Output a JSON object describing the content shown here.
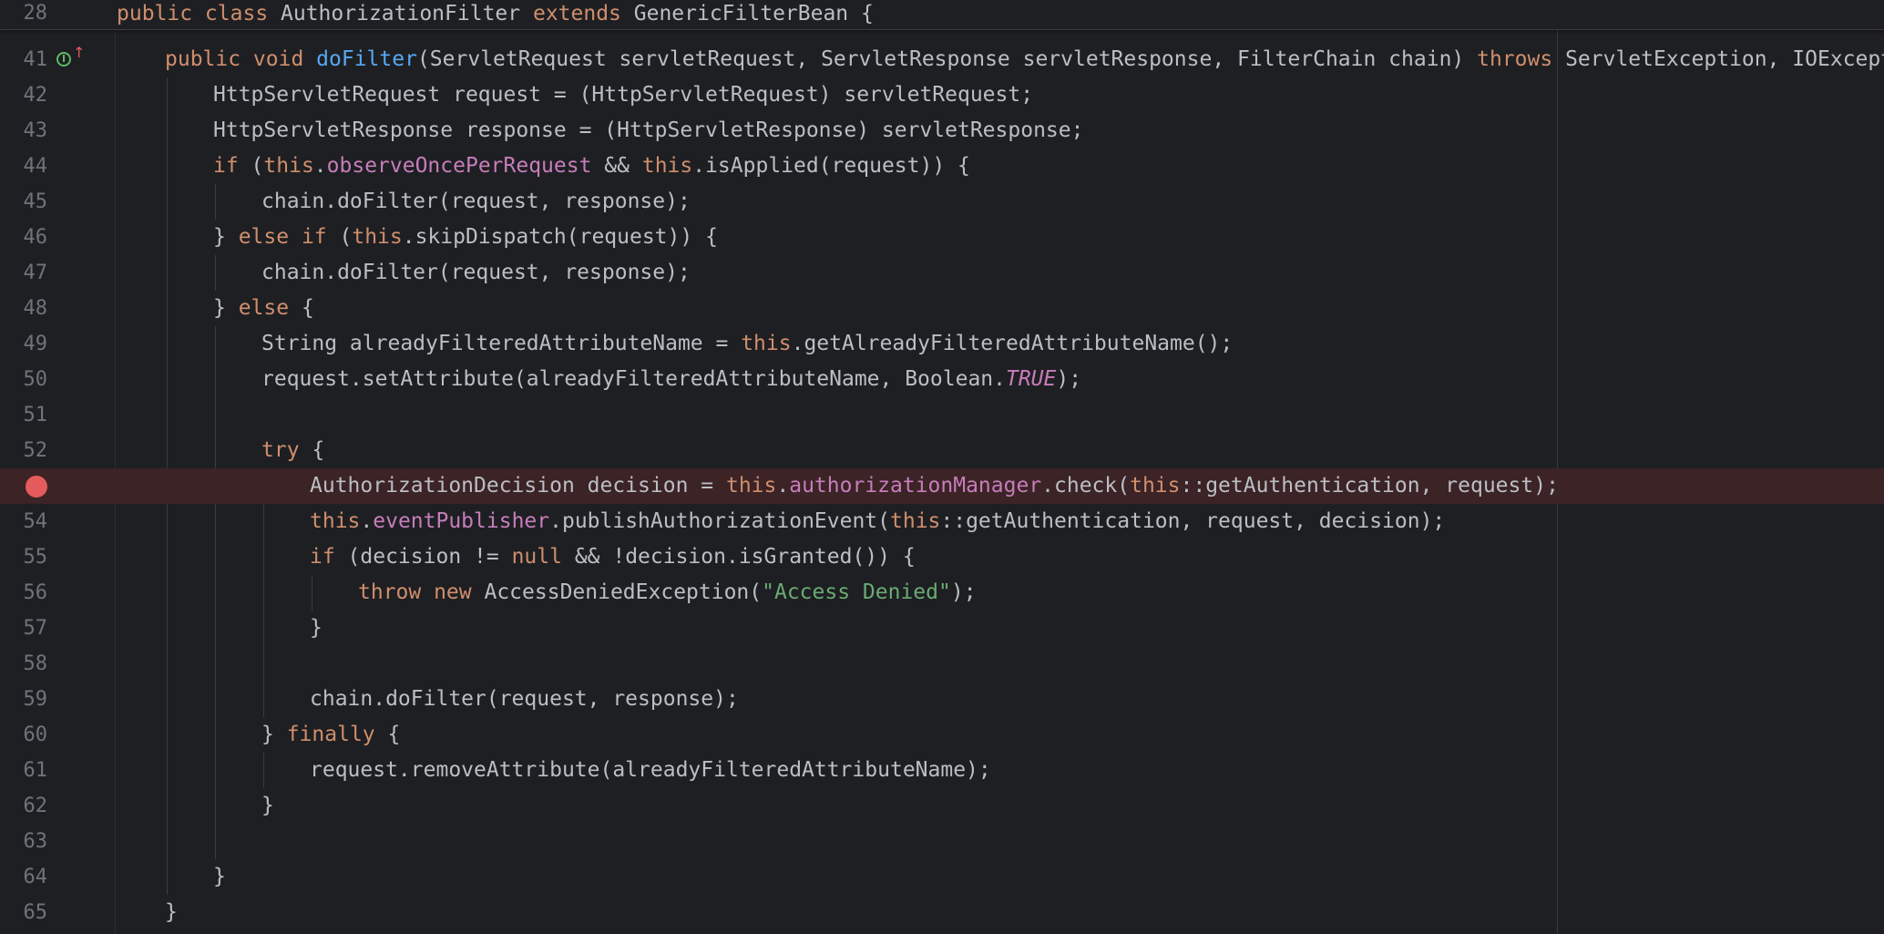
{
  "editor": {
    "sticky_header": {
      "line_number": "28",
      "tokens": [
        {
          "t": "public class ",
          "c": "kw"
        },
        {
          "t": "AuthorizationFilter ",
          "c": "txt"
        },
        {
          "t": "extends ",
          "c": "kw"
        },
        {
          "t": "GenericFilterBean {",
          "c": "txt"
        }
      ]
    },
    "lines": [
      {
        "n": "41",
        "indent": 1,
        "impl": true,
        "tokens": [
          {
            "t": "public void ",
            "c": "kw"
          },
          {
            "t": "doFilter",
            "c": "fn"
          },
          {
            "t": "(ServletRequest servletRequest, ServletResponse servletResponse, FilterChain chain) ",
            "c": "txt"
          },
          {
            "t": "throws ",
            "c": "kw"
          },
          {
            "t": "ServletException, IOException {",
            "c": "txt"
          }
        ]
      },
      {
        "n": "42",
        "indent": 2,
        "tokens": [
          {
            "t": "HttpServletRequest request = (HttpServletRequest) servletRequest;",
            "c": "txt"
          }
        ]
      },
      {
        "n": "43",
        "indent": 2,
        "tokens": [
          {
            "t": "HttpServletResponse response = (HttpServletResponse) servletResponse;",
            "c": "txt"
          }
        ]
      },
      {
        "n": "44",
        "indent": 2,
        "tokens": [
          {
            "t": "if ",
            "c": "kw"
          },
          {
            "t": "(",
            "c": "txt"
          },
          {
            "t": "this",
            "c": "kw"
          },
          {
            "t": ".",
            "c": "txt"
          },
          {
            "t": "observeOncePerRequest",
            "c": "fld"
          },
          {
            "t": " && ",
            "c": "txt"
          },
          {
            "t": "this",
            "c": "kw"
          },
          {
            "t": ".isApplied(request)) {",
            "c": "txt"
          }
        ]
      },
      {
        "n": "45",
        "indent": 3,
        "tokens": [
          {
            "t": "chain.doFilter(request, response);",
            "c": "txt"
          }
        ]
      },
      {
        "n": "46",
        "indent": 2,
        "tokens": [
          {
            "t": "} ",
            "c": "txt"
          },
          {
            "t": "else if ",
            "c": "kw"
          },
          {
            "t": "(",
            "c": "txt"
          },
          {
            "t": "this",
            "c": "kw"
          },
          {
            "t": ".skipDispatch(request)) {",
            "c": "txt"
          }
        ]
      },
      {
        "n": "47",
        "indent": 3,
        "tokens": [
          {
            "t": "chain.doFilter(request, response);",
            "c": "txt"
          }
        ]
      },
      {
        "n": "48",
        "indent": 2,
        "tokens": [
          {
            "t": "} ",
            "c": "txt"
          },
          {
            "t": "else ",
            "c": "kw"
          },
          {
            "t": "{",
            "c": "txt"
          }
        ]
      },
      {
        "n": "49",
        "indent": 3,
        "tokens": [
          {
            "t": "String alreadyFilteredAttributeName = ",
            "c": "txt"
          },
          {
            "t": "this",
            "c": "kw"
          },
          {
            "t": ".getAlreadyFilteredAttributeName();",
            "c": "txt"
          }
        ]
      },
      {
        "n": "50",
        "indent": 3,
        "tokens": [
          {
            "t": "request.setAttribute(alreadyFilteredAttributeName, Boolean.",
            "c": "txt"
          },
          {
            "t": "TRUE",
            "c": "cst"
          },
          {
            "t": ");",
            "c": "txt"
          }
        ]
      },
      {
        "n": "51",
        "indent": 3,
        "tokens": []
      },
      {
        "n": "52",
        "indent": 3,
        "tokens": [
          {
            "t": "try ",
            "c": "kw"
          },
          {
            "t": "{",
            "c": "txt"
          }
        ]
      },
      {
        "n": "",
        "indent": 4,
        "breakpoint": true,
        "tokens": [
          {
            "t": "AuthorizationDecision decision = ",
            "c": "txt"
          },
          {
            "t": "this",
            "c": "kw"
          },
          {
            "t": ".",
            "c": "txt"
          },
          {
            "t": "authorizationManager",
            "c": "fld"
          },
          {
            "t": ".check(",
            "c": "txt"
          },
          {
            "t": "this",
            "c": "kw"
          },
          {
            "t": "::getAuthentication, request);",
            "c": "txt"
          }
        ]
      },
      {
        "n": "54",
        "indent": 4,
        "tokens": [
          {
            "t": "this",
            "c": "kw"
          },
          {
            "t": ".",
            "c": "txt"
          },
          {
            "t": "eventPublisher",
            "c": "fld"
          },
          {
            "t": ".publishAuthorizationEvent(",
            "c": "txt"
          },
          {
            "t": "this",
            "c": "kw"
          },
          {
            "t": "::getAuthentication, request, decision);",
            "c": "txt"
          }
        ]
      },
      {
        "n": "55",
        "indent": 4,
        "tokens": [
          {
            "t": "if ",
            "c": "kw"
          },
          {
            "t": "(decision != ",
            "c": "txt"
          },
          {
            "t": "null ",
            "c": "kw"
          },
          {
            "t": "&& !decision.isGranted()) {",
            "c": "txt"
          }
        ]
      },
      {
        "n": "56",
        "indent": 5,
        "tokens": [
          {
            "t": "throw new ",
            "c": "kw"
          },
          {
            "t": "AccessDeniedException(",
            "c": "txt"
          },
          {
            "t": "\"Access Denied\"",
            "c": "str"
          },
          {
            "t": ");",
            "c": "txt"
          }
        ]
      },
      {
        "n": "57",
        "indent": 4,
        "tokens": [
          {
            "t": "}",
            "c": "txt"
          }
        ]
      },
      {
        "n": "58",
        "indent": 4,
        "tokens": []
      },
      {
        "n": "59",
        "indent": 4,
        "tokens": [
          {
            "t": "chain.doFilter(request, response);",
            "c": "txt"
          }
        ]
      },
      {
        "n": "60",
        "indent": 3,
        "tokens": [
          {
            "t": "} ",
            "c": "txt"
          },
          {
            "t": "finally ",
            "c": "kw"
          },
          {
            "t": "{",
            "c": "txt"
          }
        ]
      },
      {
        "n": "61",
        "indent": 4,
        "tokens": [
          {
            "t": "request.removeAttribute(alreadyFilteredAttributeName);",
            "c": "txt"
          }
        ]
      },
      {
        "n": "62",
        "indent": 3,
        "tokens": [
          {
            "t": "}",
            "c": "txt"
          }
        ]
      },
      {
        "n": "63",
        "indent": 3,
        "tokens": []
      },
      {
        "n": "64",
        "indent": 2,
        "tokens": [
          {
            "t": "}",
            "c": "txt"
          }
        ]
      },
      {
        "n": "65",
        "indent": 1,
        "tokens": [
          {
            "t": "}",
            "c": "txt"
          }
        ]
      }
    ],
    "colors": {
      "background": "#1e1f22",
      "keyword": "#cf8e6d",
      "function": "#56a8f5",
      "field": "#c77dbb",
      "string": "#6aab73",
      "text": "#bcbec4",
      "line_number": "#6f737a",
      "breakpoint": "#e55b5b",
      "breakpoint_line": "#3b2326"
    },
    "icons": {
      "breakpoint": "breakpoint-icon",
      "implements": "implements-method-icon"
    }
  }
}
